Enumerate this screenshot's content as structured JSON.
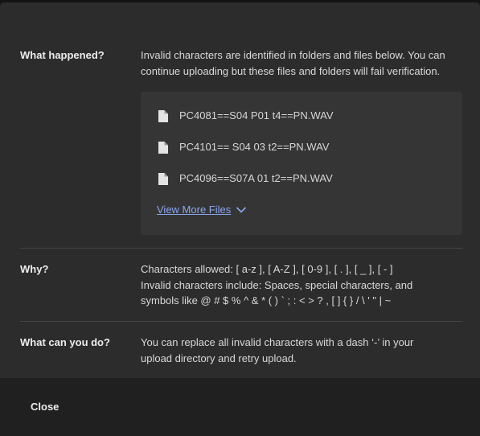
{
  "dialog": {
    "what_happened": {
      "label": "What happened?",
      "line1": "Invalid characters are identified in folders and files below. You can",
      "line2": "continue uploading but these files and folders will fail verification."
    },
    "files": [
      {
        "name": "PC4081==S04 P01 t4==PN.WAV",
        "icon": "file-icon"
      },
      {
        "name": "PC4101== S04 03 t2==PN.WAV",
        "icon": "file-icon"
      },
      {
        "name": "PC4096==S07A 01 t2==PN.WAV",
        "icon": "file-icon"
      }
    ],
    "view_more_label": "View More Files",
    "why": {
      "label": "Why?",
      "line1": "Characters allowed: [ a-z ], [ A-Z ], [ 0-9 ], [ . ], [ _ ], [ - ]",
      "line2": "Invalid characters include: Spaces, special characters, and",
      "line3": "symbols like @ # $ % ^ & * ( ) ` ; : < > ? , [ ] { } / \\ ' \" | ~"
    },
    "what_can_you_do": {
      "label": "What can you do?",
      "line1": "You can replace all invalid characters with a dash ‘-’ in your",
      "line2": "upload directory and retry upload."
    }
  },
  "footer": {
    "close_label": "Close"
  },
  "colors": {
    "link": "#8ba7ee",
    "dialog_bg": "#2c2c2c",
    "file_box_bg": "#353535"
  }
}
